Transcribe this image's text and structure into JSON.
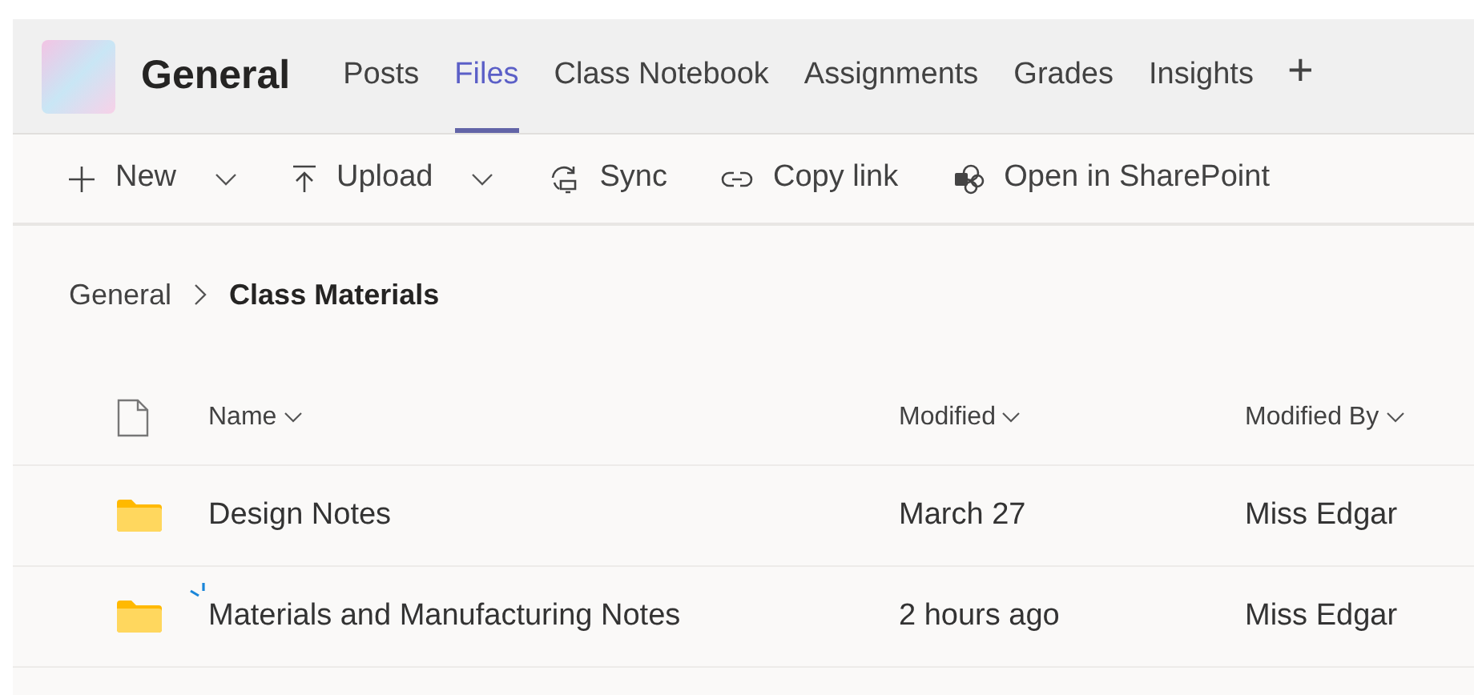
{
  "channel": {
    "title": "General"
  },
  "tabs": [
    {
      "label": "Posts",
      "selected": false
    },
    {
      "label": "Files",
      "selected": true
    },
    {
      "label": "Class Notebook",
      "selected": false
    },
    {
      "label": "Assignments",
      "selected": false
    },
    {
      "label": "Grades",
      "selected": false
    },
    {
      "label": "Insights",
      "selected": false
    }
  ],
  "add_tab": "+",
  "toolbar": [
    {
      "kind": "new",
      "label": "New",
      "dropdown": true
    },
    {
      "kind": "upload",
      "label": "Upload",
      "dropdown": true
    },
    {
      "kind": "sync",
      "label": "Sync",
      "dropdown": false
    },
    {
      "kind": "link",
      "label": "Copy link",
      "dropdown": false
    },
    {
      "kind": "sharepoint",
      "label": "Open in SharePoint",
      "dropdown": false
    }
  ],
  "breadcrumb": [
    {
      "label": "General",
      "selected": false
    },
    {
      "label": "Class Materials",
      "selected": true
    }
  ],
  "table": {
    "columns": [
      "Name",
      "Modified",
      "Modified By"
    ],
    "rows": [
      {
        "name": "Design Notes",
        "modified": "March 27",
        "modified_by": "Miss Edgar",
        "new": false
      },
      {
        "name": "Materials and Manufacturing Notes",
        "modified": "2 hours ago",
        "modified_by": "Miss Edgar",
        "new": true
      }
    ]
  }
}
